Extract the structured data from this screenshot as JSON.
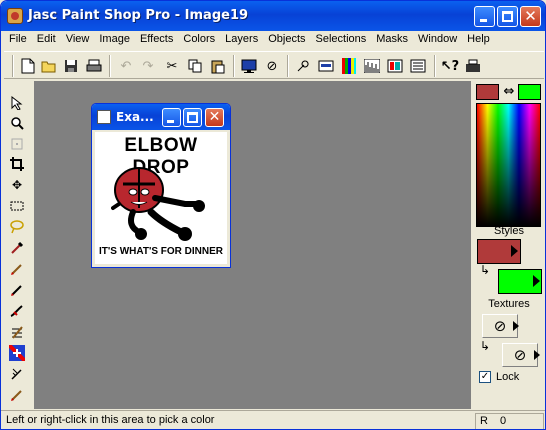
{
  "app": {
    "title": "Jasc Paint Shop Pro - Image19"
  },
  "menu": [
    "File",
    "Edit",
    "View",
    "Image",
    "Effects",
    "Colors",
    "Layers",
    "Objects",
    "Selections",
    "Masks",
    "Window",
    "Help"
  ],
  "toolbar": {
    "icons": [
      "new-file-icon",
      "open-folder-icon",
      "save-icon",
      "print-icon",
      "undo-icon",
      "redo-icon",
      "cut-icon",
      "copy-icon",
      "paste-icon",
      "browse-monitor-icon",
      "no-entry-icon",
      "overview-icon",
      "tool-options-icon",
      "histogram-icon",
      "layers-palette-icon",
      "color-palette-icon",
      "script-icon",
      "context-help-icon",
      "scanner-icon"
    ]
  },
  "tools": [
    "arrow-icon",
    "zoom-icon",
    "deform-icon",
    "crop-icon",
    "move-icon",
    "selection-icon",
    "freehand-selection-icon",
    "dropper-icon",
    "paint-brush-icon",
    "clone-brush-icon",
    "color-replacer-icon",
    "retouch-icon",
    "scratch-remover-icon",
    "eraser-icon",
    "picture-tube-icon",
    "airbrush-icon"
  ],
  "image_window": {
    "title": "Exa...",
    "text_top": "ELBOW DROP",
    "text_bottom": "IT'S WHAT'S FOR DINNER"
  },
  "color_palette": {
    "foreground_color": "#b03a3a",
    "background_color": "#00ff00",
    "styles_label": "Styles",
    "textures_label": "Textures",
    "lock_label": "Lock",
    "lock_checked": true
  },
  "status": {
    "text": "Left or right-click in this area to pick a color",
    "r_label": "R",
    "r_value": "0"
  }
}
